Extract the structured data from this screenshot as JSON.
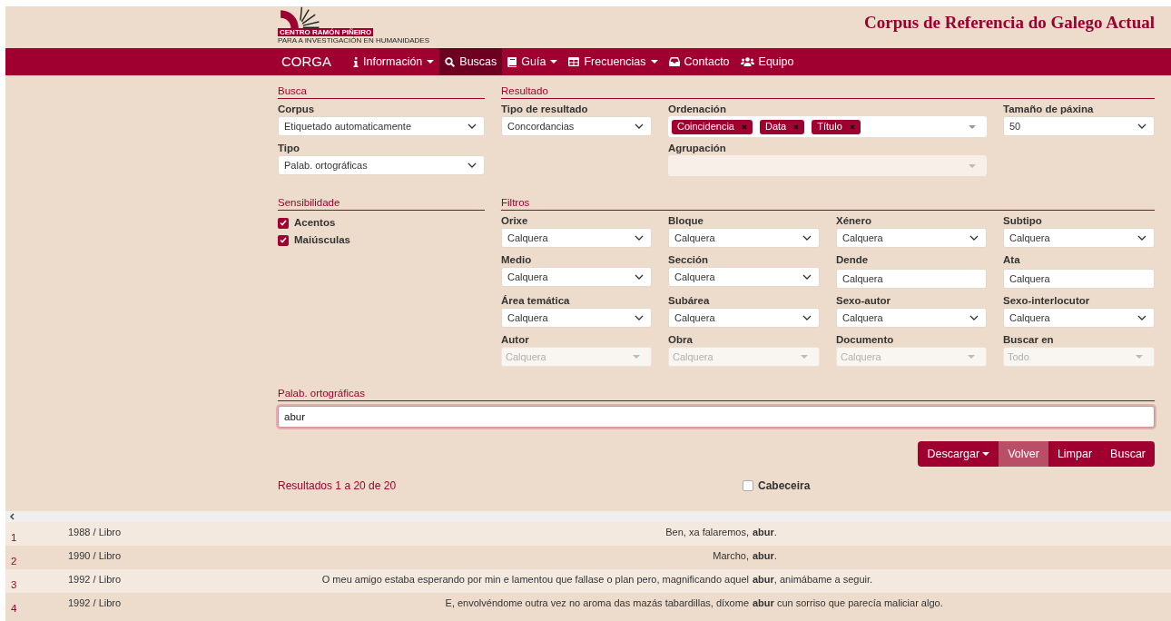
{
  "header": {
    "logo_lines": [
      "CENTRO RAMÓN PIÑEIRO",
      "PARA A INVESTIGACIÓN EN HUMANIDADES"
    ],
    "title": "Corpus de Referencia do Galego Actual"
  },
  "navbar": {
    "brand": "CORGA",
    "items": [
      {
        "label": "Información",
        "kind": "info",
        "dropdown": true,
        "selected": false
      },
      {
        "label": "Buscas",
        "kind": "search",
        "dropdown": false,
        "selected": true
      },
      {
        "label": "Guía",
        "kind": "book",
        "dropdown": true,
        "selected": false
      },
      {
        "label": "Frecuencias",
        "kind": "table",
        "dropdown": true,
        "selected": false
      },
      {
        "label": "Contacto",
        "kind": "inbox",
        "dropdown": false,
        "selected": false
      },
      {
        "label": "Equipo",
        "kind": "users",
        "dropdown": false,
        "selected": false
      }
    ]
  },
  "busca": {
    "heading": "Busca",
    "fields": [
      {
        "label": "Corpus",
        "value": "Etiquetado automaticamente"
      },
      {
        "label": "Tipo",
        "value": "Palab. ortográficas"
      }
    ]
  },
  "resultado": {
    "heading": "Resultado",
    "tipo": {
      "label": "Tipo de resultado",
      "value": "Concordancias"
    },
    "ordenacion": {
      "label": "Ordenación",
      "tags": [
        "Coincidencia",
        "Data",
        "Título"
      ]
    },
    "agrupacion": {
      "label": "Agrupación",
      "disabled": true
    },
    "tamano": {
      "label": "Tamaño de páxina",
      "value": "50"
    }
  },
  "sensibilidade": {
    "heading": "Sensibilidade",
    "options": [
      {
        "label": "Acentos",
        "checked": true
      },
      {
        "label": "Maiúsculas",
        "checked": true
      }
    ]
  },
  "filtros": {
    "heading": "Filtros",
    "fields": [
      {
        "label": "Orixe",
        "kind": "select",
        "value": "Calquera"
      },
      {
        "label": "Bloque",
        "kind": "select",
        "value": "Calquera"
      },
      {
        "label": "Xénero",
        "kind": "select",
        "value": "Calquera"
      },
      {
        "label": "Subtipo",
        "kind": "select",
        "value": "Calquera"
      },
      {
        "label": "Medio",
        "kind": "select",
        "value": "Calquera"
      },
      {
        "label": "Sección",
        "kind": "select",
        "value": "Calquera"
      },
      {
        "label": "Dende",
        "kind": "text",
        "value": "Calquera"
      },
      {
        "label": "Ata",
        "kind": "text",
        "value": "Calquera"
      },
      {
        "label": "Área temática",
        "kind": "select",
        "value": "Calquera"
      },
      {
        "label": "Subárea",
        "kind": "select",
        "value": "Calquera"
      },
      {
        "label": "Sexo-autor",
        "kind": "select",
        "value": "Calquera"
      },
      {
        "label": "Sexo-interlocutor",
        "kind": "select",
        "value": "Calquera"
      },
      {
        "label": "Autor",
        "kind": "combo",
        "placeholder": "Calquera",
        "disabled": true
      },
      {
        "label": "Obra",
        "kind": "combo",
        "placeholder": "Calquera",
        "disabled": true
      },
      {
        "label": "Documento",
        "kind": "combo",
        "placeholder": "Calquera",
        "disabled": true
      },
      {
        "label": "Buscar en",
        "kind": "combo",
        "placeholder": "Todo",
        "disabled": true
      }
    ]
  },
  "query": {
    "label": "Palab. ortográficas",
    "value": "abur"
  },
  "buttons": [
    {
      "label": "Descargar",
      "dropdown": true,
      "selected": false
    },
    {
      "label": "Volver",
      "dropdown": false,
      "selected": true
    },
    {
      "label": "Limpar",
      "dropdown": false,
      "selected": false
    },
    {
      "label": "Buscar",
      "dropdown": false,
      "selected": false
    }
  ],
  "results": {
    "summary": "Resultados 1 a 20 de 20",
    "header_option": {
      "label": "Cabeceira",
      "checked": false
    },
    "rows": [
      {
        "number": "1",
        "source": "1988 / Libro",
        "left": "Ben, xa falaremos,",
        "match": "abur",
        "right": "."
      },
      {
        "number": "2",
        "source": "1990 / Libro",
        "left": "Marcho,",
        "match": "abur",
        "right": "."
      },
      {
        "number": "3",
        "source": "1992 / Libro",
        "left": "O meu amigo estaba esperando por min e lamentou que fallase o plan pero, magnificando aquel",
        "match": "abur",
        "right": ", animábame a seguir."
      },
      {
        "number": "4",
        "source": "1992 / Libro",
        "left": "E, envolvéndome outra vez no aroma das mazás tabardillas, díxome",
        "match": "abur",
        "right": " cun sorriso que parecía maliciar algo."
      }
    ]
  }
}
